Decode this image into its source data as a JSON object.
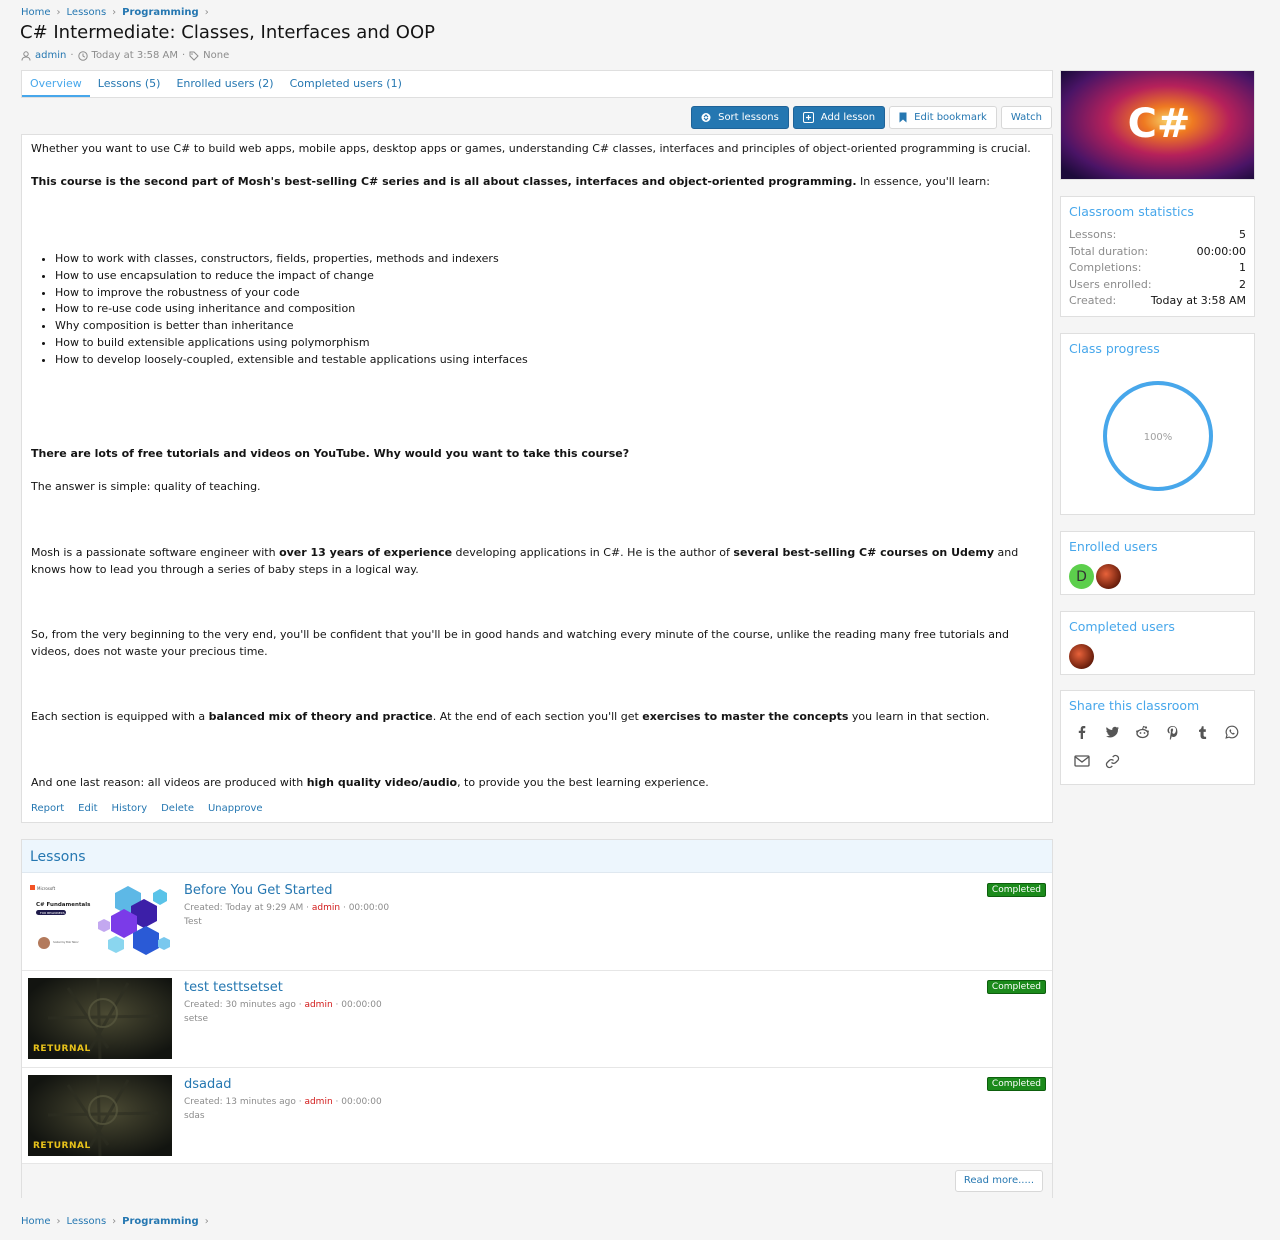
{
  "breadcrumb": {
    "home": "Home",
    "lessons": "Lessons",
    "current": "Programming"
  },
  "page": {
    "title": "C# Intermediate: Classes, Interfaces and OOP",
    "author": "admin",
    "date": "Today at 3:58 AM",
    "tags": "None"
  },
  "tabs": [
    "Overview",
    "Lessons (5)",
    "Enrolled users (2)",
    "Completed users (1)"
  ],
  "buttons": {
    "sort": "Sort lessons",
    "add": "Add lesson",
    "bookmark": "Edit bookmark",
    "watch": "Watch"
  },
  "description": {
    "p1": "Whether you want to use C# to build web apps, mobile apps, desktop apps or games, understanding C# classes, interfaces and principles of object-oriented programming is crucial.",
    "p2_bold": "This course is the second part of Mosh's best-selling C# series and is all about classes, interfaces and object-oriented programming.",
    "p2_rest": " In essence, you'll learn:",
    "bullets": [
      "How to work with classes, constructors, fields, properties, methods and indexers",
      "How to use encapsulation to reduce the impact of change",
      "How to improve the robustness of your code",
      "How to re-use code using inheritance and composition",
      "Why composition is better than inheritance",
      "How to build extensible applications using polymorphism",
      "How to develop loosely-coupled, extensible and testable applications using interfaces"
    ],
    "p3_bold": "There are lots of free tutorials and videos on YouTube. Why would you want to take this course?",
    "p4": "The answer is simple: quality of teaching.",
    "p5_a": "Mosh is a passionate software engineer with ",
    "p5_b": "over 13 years of experience",
    "p5_c": " developing applications in C#. He is the author of ",
    "p5_d": "several best-selling C# courses on Udemy",
    "p5_e": " and knows how to lead you through a series of baby steps in a logical way.",
    "p6": "So, from the very beginning to the very end, you'll be confident that you'll be in good hands and watching every minute of the course, unlike the reading many free tutorials and videos, does not waste your precious time.",
    "p7_a": "Each section is equipped with a ",
    "p7_b": "balanced mix of theory and practice",
    "p7_c": ". At the end of each section you'll get ",
    "p7_d": "exercises to master the concepts",
    "p7_e": " you learn in that section.",
    "p8_a": "And one last reason: all videos are produced with ",
    "p8_b": "high quality video/audio",
    "p8_c": ", to provide you the best learning experience.",
    "actions": [
      "Report",
      "Edit",
      "History",
      "Delete",
      "Unapprove"
    ]
  },
  "lessons": {
    "heading": "Lessons",
    "items": [
      {
        "title": "Before You Get Started",
        "created": "Created: Today at 9:29 AM",
        "author": "admin",
        "duration": "00:00:00",
        "note": "Test",
        "status": "Completed",
        "thumb_title": "C# Fundamentals",
        "thumb_brand": "Microsoft",
        "thumb_tag": "FOR BEGINNERS",
        "thumb_host": "hosted by Bob Tabor"
      },
      {
        "title": "test testtsetset",
        "created": "Created: 30 minutes ago",
        "author": "admin",
        "duration": "00:00:00",
        "note": "setse",
        "status": "Completed",
        "thumb_title": "RETURNAL"
      },
      {
        "title": "dsadad",
        "created": "Created: 13 minutes ago",
        "author": "admin",
        "duration": "00:00:00",
        "note": "sdas",
        "status": "Completed",
        "thumb_title": "RETURNAL"
      }
    ],
    "read_more": "Read more....."
  },
  "sidebar": {
    "cover_text": "C#",
    "stats": {
      "heading": "Classroom statistics",
      "rows": [
        {
          "k": "Lessons:",
          "v": "5"
        },
        {
          "k": "Total duration:",
          "v": "00:00:00"
        },
        {
          "k": "Completions:",
          "v": "1"
        },
        {
          "k": "Users enrolled:",
          "v": "2"
        },
        {
          "k": "Created:",
          "v": "Today at 3:58 AM"
        }
      ]
    },
    "progress": {
      "heading": "Class progress",
      "label": "100%",
      "value": 100
    },
    "enrolled": {
      "heading": "Enrolled users",
      "first_initial": "D"
    },
    "completed": {
      "heading": "Completed users"
    },
    "share": {
      "heading": "Share this classroom"
    }
  },
  "colors": {
    "accent": "#2577b1",
    "link_light": "#47a7eb",
    "completed": "#1b8a1b",
    "admin": "#d21b1b"
  }
}
